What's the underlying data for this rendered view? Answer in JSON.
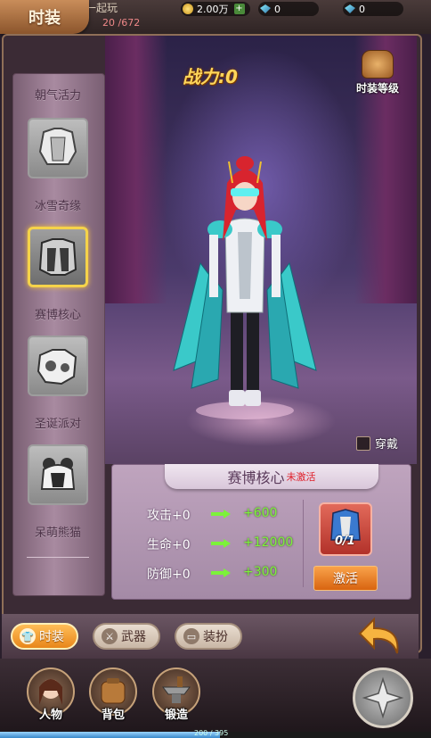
{
  "top": {
    "title": "时装",
    "friend_text": "一起玩",
    "hp_text": "20 /672",
    "gold": "2.00万",
    "gem_a": "0",
    "gem_b": "0"
  },
  "power": {
    "label": "战力:",
    "value": "0"
  },
  "fashion_level_label": "时装等级",
  "sidebar": {
    "items": [
      {
        "label": "朝气活力",
        "icon": "outfit-icon"
      },
      {
        "label": "冰雪奇缘",
        "icon": "outfit-icon"
      },
      {
        "label": "赛博核心",
        "icon": "outfit-icon",
        "selected": true
      },
      {
        "label": "圣诞派对",
        "icon": "outfit-icon"
      },
      {
        "label": "呆萌熊猫",
        "icon": "outfit-icon"
      }
    ]
  },
  "wear_label": "穿戴",
  "set": {
    "name": "赛博核心",
    "status": "未激活",
    "stats": [
      {
        "name": "攻击+0",
        "bonus": "+600"
      },
      {
        "name": "生命+0",
        "bonus": "+12000"
      },
      {
        "name": "防御+0",
        "bonus": "+300"
      }
    ],
    "pieces_count": "0/1",
    "activate_label": "激活"
  },
  "tabs": [
    {
      "label": "时装",
      "icon": "shirt-icon",
      "active": true
    },
    {
      "label": "武器",
      "icon": "weapon-icon",
      "active": false
    },
    {
      "label": "装扮",
      "icon": "decor-icon",
      "active": false
    }
  ],
  "bottom_nav": [
    {
      "label": "人物",
      "icon": "character-icon"
    },
    {
      "label": "背包",
      "icon": "backpack-icon"
    },
    {
      "label": "锻造",
      "icon": "anvil-icon"
    }
  ],
  "exp": {
    "text": "200 / 395",
    "fraction": 0.51
  },
  "colors": {
    "accent": "#f5a030",
    "stat_bonus": "#7cf23a",
    "status_red": "#e0202a",
    "power": "#ffd65a"
  }
}
